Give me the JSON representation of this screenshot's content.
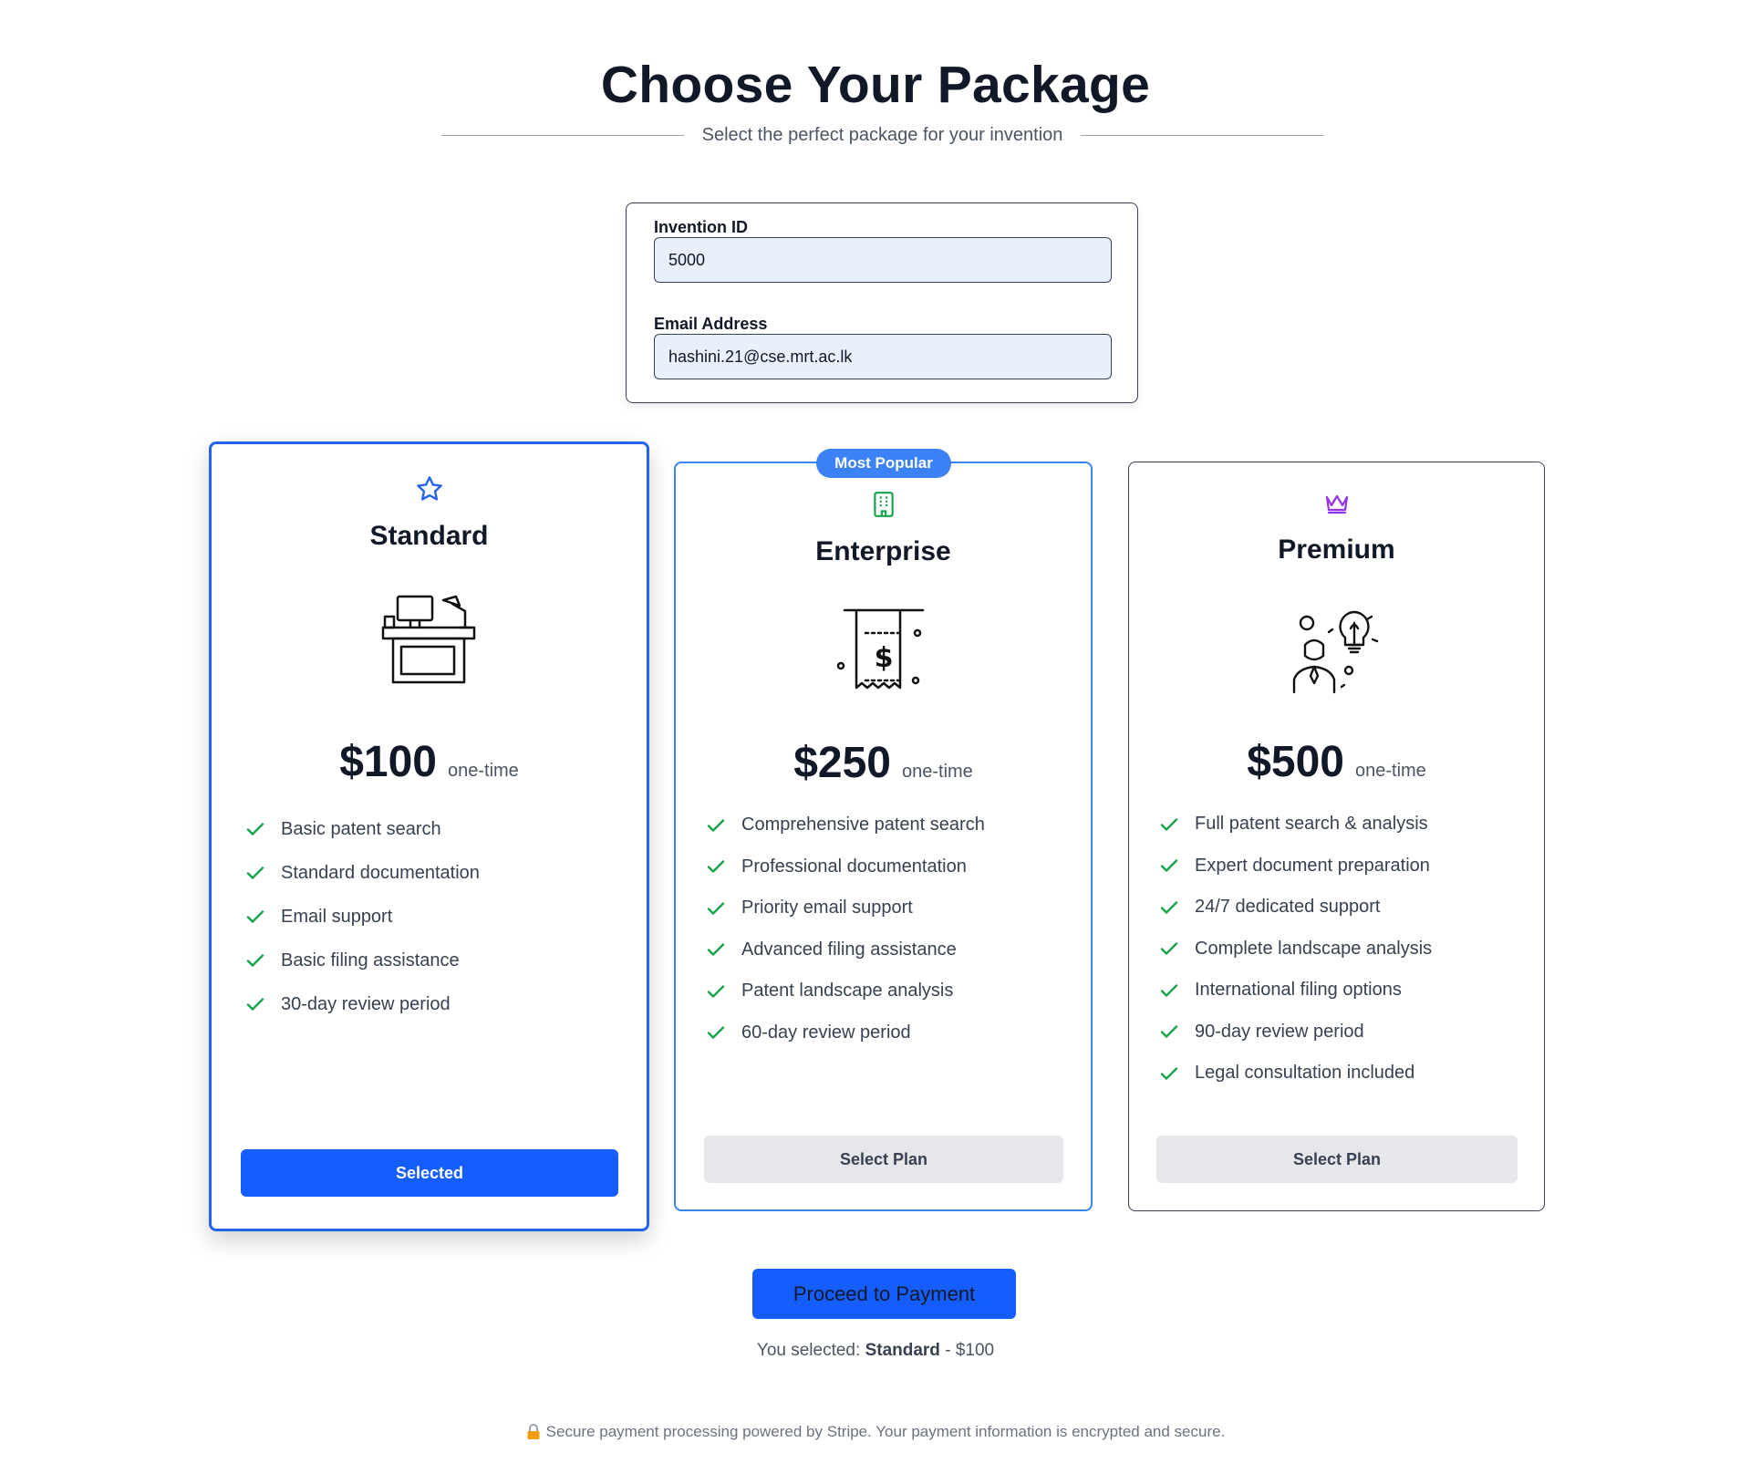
{
  "header": {
    "title": "Choose Your Package",
    "subtitle": "Select the perfect package for your invention"
  },
  "form": {
    "invention_label": "Invention ID",
    "invention_value": "5000",
    "email_label": "Email Address",
    "email_value": "hashini.21@cse.mrt.ac.lk"
  },
  "plans": [
    {
      "name": "Standard",
      "icon": "star-icon",
      "icon_color": "#2563eb",
      "price": "$100",
      "period": "one-time",
      "features": [
        "Basic patent search",
        "Standard documentation",
        "Email support",
        "Basic filing assistance",
        "30-day review period"
      ],
      "button": "Selected",
      "selected": true
    },
    {
      "name": "Enterprise",
      "badge": "Most Popular",
      "icon": "building-icon",
      "icon_color": "#16a34a",
      "price": "$250",
      "period": "one-time",
      "features": [
        "Comprehensive patent search",
        "Professional documentation",
        "Priority email support",
        "Advanced filing assistance",
        "Patent landscape analysis",
        "60-day review period"
      ],
      "button": "Select Plan",
      "selected": false
    },
    {
      "name": "Premium",
      "icon": "crown-icon",
      "icon_color": "#9333ea",
      "price": "$500",
      "period": "one-time",
      "features": [
        "Full patent search & analysis",
        "Expert document preparation",
        "24/7 dedicated support",
        "Complete landscape analysis",
        "International filing options",
        "90-day review period",
        "Legal consultation included"
      ],
      "button": "Select Plan",
      "selected": false
    }
  ],
  "proceed_button": "Proceed to Payment",
  "summary": {
    "prefix": "You selected: ",
    "plan": "Standard",
    "separator": " - ",
    "price": "$100"
  },
  "secure_note": "Secure payment processing powered by Stripe. Your payment information is encrypted and secure.",
  "colors": {
    "accent": "#155efd",
    "check": "#16a34a"
  }
}
